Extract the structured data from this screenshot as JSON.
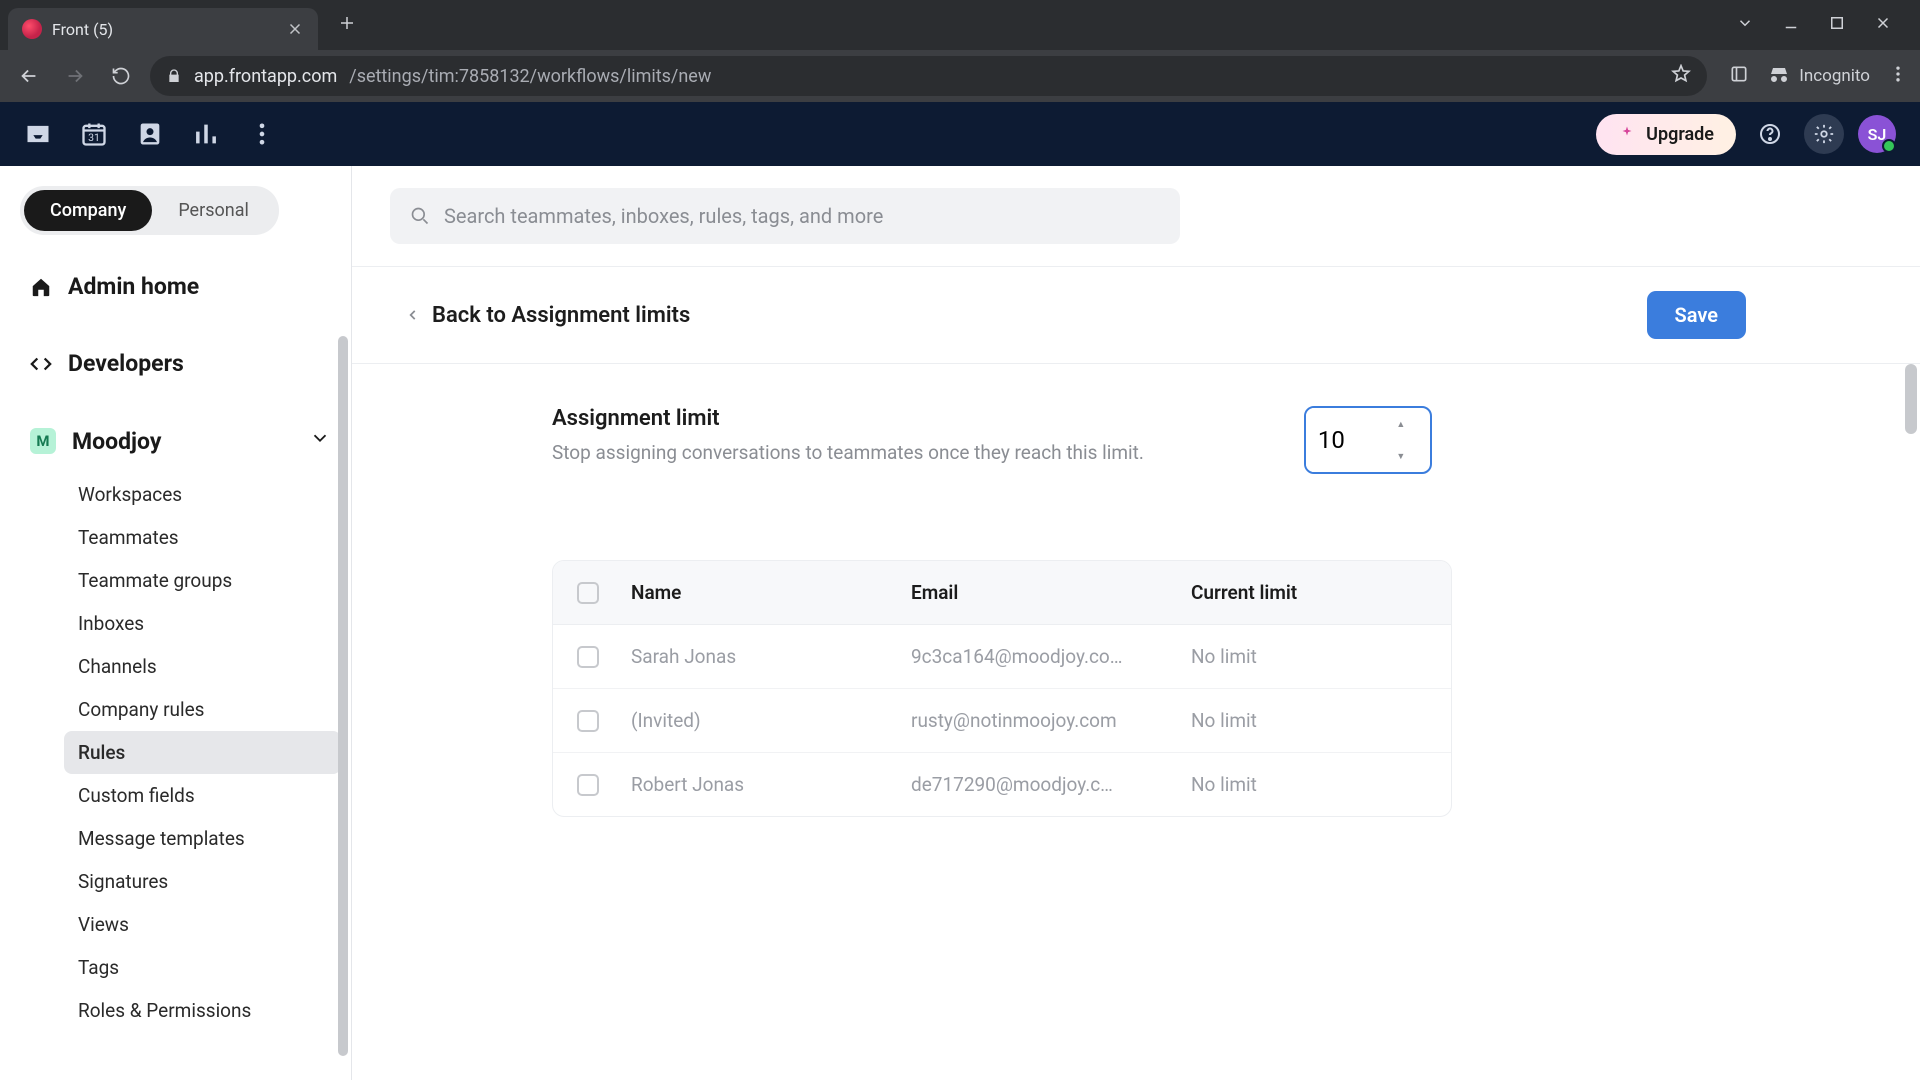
{
  "browser": {
    "tab_title": "Front (5)",
    "url_host": "app.frontapp.com",
    "url_path": "/settings/tim:7858132/workflows/limits/new",
    "incognito_label": "Incognito"
  },
  "topnav": {
    "upgrade_label": "Upgrade",
    "avatar_initials": "SJ"
  },
  "sidebar": {
    "scope_company": "Company",
    "scope_personal": "Personal",
    "admin_home": "Admin home",
    "developers": "Developers",
    "workspace_badge": "M",
    "workspace_name": "Moodjoy",
    "items": [
      "Workspaces",
      "Teammates",
      "Teammate groups",
      "Inboxes",
      "Channels",
      "Company rules",
      "Rules",
      "Custom fields",
      "Message templates",
      "Signatures",
      "Views",
      "Tags",
      "Roles & Permissions"
    ],
    "active_index": 6
  },
  "search": {
    "placeholder": "Search teammates, inboxes, rules, tags, and more"
  },
  "header": {
    "back_label": "Back to Assignment limits",
    "save_label": "Save"
  },
  "assignment_limit": {
    "title": "Assignment limit",
    "description": "Stop assigning conversations to teammates once they reach this limit.",
    "value": "10"
  },
  "table": {
    "columns": {
      "name": "Name",
      "email": "Email",
      "limit": "Current limit"
    },
    "rows": [
      {
        "name": "Sarah Jonas",
        "email": "9c3ca164@moodjoy.co…",
        "limit": "No limit"
      },
      {
        "name": "(Invited)",
        "email": "rusty@notinmoojoy.com",
        "limit": "No limit"
      },
      {
        "name": "Robert Jonas",
        "email": "de717290@moodjoy.c…",
        "limit": "No limit"
      }
    ]
  }
}
